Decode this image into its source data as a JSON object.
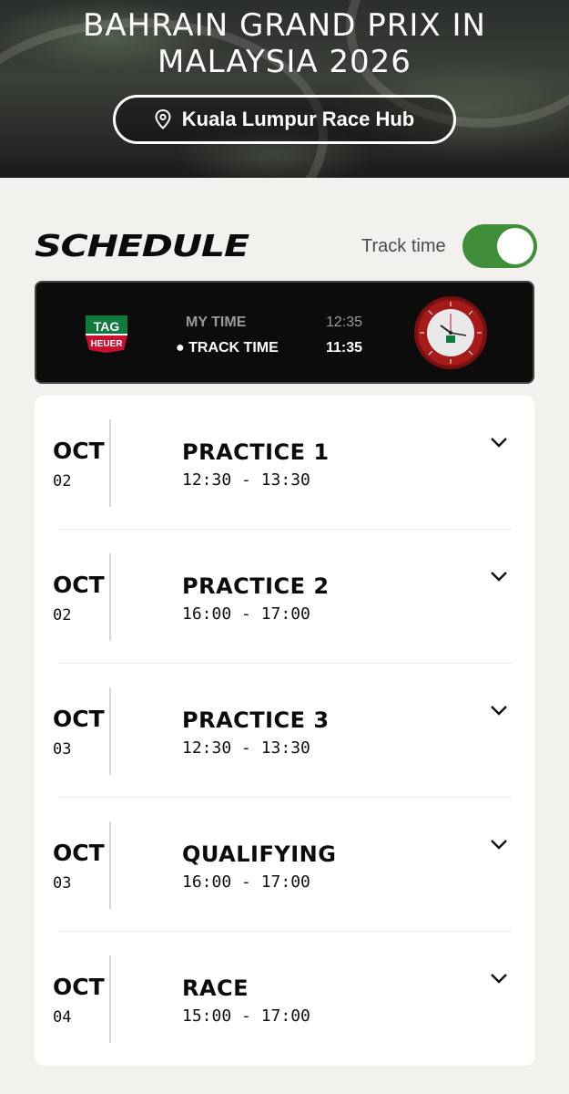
{
  "hero": {
    "title_line1": "BAHRAIN GRAND PRIX IN",
    "title_line2": "MALAYSIA 2026",
    "hub_label": "Kuala Lumpur Race Hub"
  },
  "schedule": {
    "title": "SCHEDULE",
    "track_time_label": "Track time",
    "track_time_enabled": true
  },
  "clock": {
    "brand_top": "TAG",
    "brand_bottom": "HEUER",
    "my_time_label": "MY TIME",
    "track_time_label": "TRACK TIME",
    "my_time_value": "12:35",
    "track_time_value": "11:35"
  },
  "sessions": [
    {
      "month": "OCT",
      "day": "02",
      "name": "PRACTICE 1",
      "time": "12:30 - 13:30"
    },
    {
      "month": "OCT",
      "day": "02",
      "name": "PRACTICE 2",
      "time": "16:00 - 17:00"
    },
    {
      "month": "OCT",
      "day": "03",
      "name": "PRACTICE 3",
      "time": "12:30 - 13:30"
    },
    {
      "month": "OCT",
      "day": "03",
      "name": "QUALIFYING",
      "time": "16:00 - 17:00"
    },
    {
      "month": "OCT",
      "day": "04",
      "name": "RACE",
      "time": "15:00 - 17:00"
    }
  ],
  "colors": {
    "toggle_on": "#3f8f3a",
    "tag_green": "#0f7a3c",
    "tag_red": "#c8102e",
    "watch_bezel": "#a61a1a"
  }
}
